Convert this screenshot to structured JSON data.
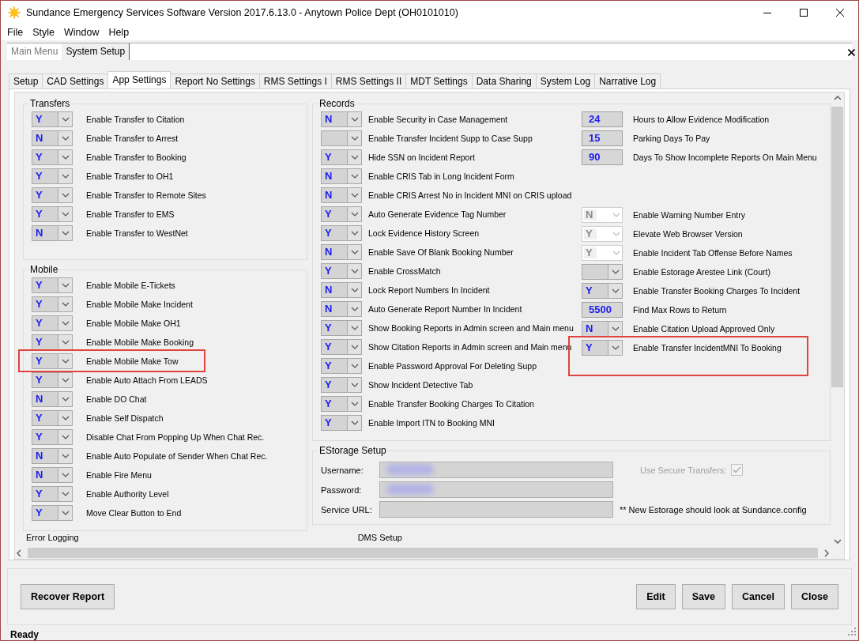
{
  "window": {
    "title": "Sundance Emergency Services Software Version 2017.6.13.0 - Anytown Police Dept (OH0101010)"
  },
  "menu": [
    "File",
    "Style",
    "Window",
    "Help"
  ],
  "doc_tabs": [
    {
      "label": "Main Menu",
      "selected": false
    },
    {
      "label": "System Setup",
      "selected": true
    }
  ],
  "tabs": [
    {
      "label": "Setup",
      "selected": false
    },
    {
      "label": "CAD Settings",
      "selected": false
    },
    {
      "label": "App Settings",
      "selected": true
    },
    {
      "label": "Report No Settings",
      "selected": false
    },
    {
      "label": "RMS Settings I",
      "selected": false
    },
    {
      "label": "RMS Settings II",
      "selected": false
    },
    {
      "label": "MDT Settings",
      "selected": false
    },
    {
      "label": "Data Sharing",
      "selected": false
    },
    {
      "label": "System Log",
      "selected": false
    },
    {
      "label": "Narrative Log",
      "selected": false
    }
  ],
  "transfers": {
    "title": "Transfers",
    "items": [
      {
        "kind": "combo",
        "value": "Y",
        "label": "Enable Transfer to Citation",
        "disabled": false,
        "highlighted": false
      },
      {
        "kind": "combo",
        "value": "N",
        "label": "Enable Transfer to Arrest",
        "disabled": false,
        "highlighted": false
      },
      {
        "kind": "combo",
        "value": "Y",
        "label": "Enable Transfer to Booking",
        "disabled": false,
        "highlighted": false
      },
      {
        "kind": "combo",
        "value": "Y",
        "label": "Enable Transfer to OH1",
        "disabled": false,
        "highlighted": false
      },
      {
        "kind": "combo",
        "value": "Y",
        "label": "Enable Transfer to Remote Sites",
        "disabled": false,
        "highlighted": false
      },
      {
        "kind": "combo",
        "value": "Y",
        "label": "Enable Transfer to EMS",
        "disabled": false,
        "highlighted": false
      },
      {
        "kind": "combo",
        "value": "N",
        "label": "Enable Transfer to WestNet",
        "disabled": false,
        "highlighted": false
      }
    ]
  },
  "mobile": {
    "title": "Mobile",
    "items": [
      {
        "kind": "combo",
        "value": "Y",
        "label": "Enable Mobile E-Tickets",
        "disabled": false,
        "highlighted": false
      },
      {
        "kind": "combo",
        "value": "Y",
        "label": "Enable Mobile Make Incident",
        "disabled": false,
        "highlighted": false
      },
      {
        "kind": "combo",
        "value": "Y",
        "label": "Enable Mobile Make OH1",
        "disabled": false,
        "highlighted": false
      },
      {
        "kind": "combo",
        "value": "Y",
        "label": "Enable Mobile Make Booking",
        "disabled": false,
        "highlighted": false
      },
      {
        "kind": "combo",
        "value": "Y",
        "label": "Enable Mobile Make Tow",
        "disabled": false,
        "highlighted": true
      },
      {
        "kind": "combo",
        "value": "Y",
        "label": "Enable Auto Attach From LEADS",
        "disabled": false,
        "highlighted": false
      },
      {
        "kind": "combo",
        "value": "N",
        "label": "Enable DO Chat",
        "disabled": false,
        "highlighted": false
      },
      {
        "kind": "combo",
        "value": "Y",
        "label": "Enable Self Dispatch",
        "disabled": false,
        "highlighted": false
      },
      {
        "kind": "combo",
        "value": "Y",
        "label": "Disable Chat From Popping Up When Chat Rec.",
        "disabled": false,
        "highlighted": false
      },
      {
        "kind": "combo",
        "value": "N",
        "label": "Enable Auto Populate of Sender When Chat Rec.",
        "disabled": false,
        "highlighted": false
      },
      {
        "kind": "combo",
        "value": "N",
        "label": "Enable Fire Menu",
        "disabled": false,
        "highlighted": false
      },
      {
        "kind": "combo",
        "value": "Y",
        "label": "Enable Authority Level",
        "disabled": false,
        "highlighted": false
      },
      {
        "kind": "combo",
        "value": "Y",
        "label": "Move Clear Button to End",
        "disabled": false,
        "highlighted": false
      }
    ]
  },
  "records": {
    "title": "Records",
    "left": [
      {
        "kind": "combo",
        "value": "N",
        "label": "Enable Security in Case Management",
        "disabled": false,
        "highlighted": false
      },
      {
        "kind": "combo",
        "label": "Enable Transfer Incident Supp to Case Supp",
        "disabled": false,
        "highlighted": false
      },
      {
        "kind": "combo",
        "value": "Y",
        "label": "Hide SSN on Incident Report",
        "disabled": false,
        "highlighted": false
      },
      {
        "kind": "combo",
        "value": "N",
        "label": "Enable CRIS Tab in Long Incident Form",
        "disabled": false,
        "highlighted": false
      },
      {
        "kind": "combo",
        "value": "N",
        "label": "Enable CRIS Arrest No in Incident MNI on CRIS upload",
        "disabled": false,
        "highlighted": false
      },
      {
        "kind": "combo",
        "value": "Y",
        "label": "Auto Generate Evidence Tag Number",
        "disabled": false,
        "highlighted": false
      },
      {
        "kind": "combo",
        "value": "Y",
        "label": "Lock Evidence History Screen",
        "disabled": false,
        "highlighted": false
      },
      {
        "kind": "combo",
        "value": "N",
        "label": "Enable Save Of Blank Booking Number",
        "disabled": false,
        "highlighted": false
      },
      {
        "kind": "combo",
        "value": "Y",
        "label": "Enable CrossMatch",
        "disabled": false,
        "highlighted": false
      },
      {
        "kind": "combo",
        "value": "N",
        "label": "Lock Report Numbers In Incident",
        "disabled": false,
        "highlighted": false
      },
      {
        "kind": "combo",
        "value": "N",
        "label": "Auto Generate Report Number In Incident",
        "disabled": false,
        "highlighted": false
      },
      {
        "kind": "combo",
        "value": "Y",
        "label": "Show Booking Reports in Admin screen and Main menu",
        "disabled": false,
        "highlighted": false
      },
      {
        "kind": "combo",
        "value": "Y",
        "label": "Show Citation Reports in Admin screen and Main menu",
        "disabled": false,
        "highlighted": false
      },
      {
        "kind": "combo",
        "value": "Y",
        "label": "Enable Password Approval For Deleting Supp",
        "disabled": false,
        "highlighted": false
      },
      {
        "kind": "combo",
        "value": "Y",
        "label": "Show Incident Detective Tab",
        "disabled": false,
        "highlighted": false
      },
      {
        "kind": "combo",
        "value": "Y",
        "label": "Enable Transfer Booking Charges To Citation",
        "disabled": false,
        "highlighted": false
      },
      {
        "kind": "combo",
        "value": "Y",
        "label": "Enable Import ITN to Booking MNI",
        "disabled": false,
        "highlighted": false
      }
    ],
    "right_top": [
      {
        "kind": "number",
        "value": "24",
        "label": "Hours to Allow Evidence Modification",
        "highlighted": false
      },
      {
        "kind": "number",
        "value": "15",
        "label": "Parking Days To Pay",
        "highlighted": false
      },
      {
        "kind": "number",
        "value": "90",
        "label": "Days To Show Incomplete Reports On Main Menu",
        "highlighted": false
      }
    ],
    "right_bottom": [
      {
        "kind": "combo",
        "value": "N",
        "label": "Enable Warning Number Entry",
        "disabled": true,
        "highlighted": false
      },
      {
        "kind": "combo",
        "value": "Y",
        "label": "Elevate Web Browser Version",
        "disabled": true,
        "highlighted": false
      },
      {
        "kind": "combo",
        "value": "Y",
        "label": "Enable Incident Tab Offense Before Names",
        "disabled": true,
        "highlighted": false
      },
      {
        "kind": "combo",
        "label": "Enable Estorage Arestee Link (Court)",
        "disabled": false,
        "highlighted": false
      },
      {
        "kind": "combo",
        "value": "Y",
        "label": "Enable Transfer Booking Charges To Incident",
        "disabled": false,
        "highlighted": false
      },
      {
        "kind": "number",
        "value": "5500",
        "label": "Find Max Rows to Return",
        "highlighted": false
      },
      {
        "kind": "combo",
        "value": "N",
        "label": "Enable Citation Upload Approved Only",
        "disabled": false,
        "highlighted": false
      },
      {
        "kind": "combo",
        "value": "Y",
        "label": "Enable Transfer IncidentMNI To Booking",
        "disabled": false,
        "highlighted": true
      }
    ]
  },
  "estorage": {
    "title": "EStorage Setup",
    "fields": [
      {
        "label": "Username:",
        "redacted": true
      },
      {
        "label": "Password:",
        "redacted": true
      },
      {
        "label": "Service URL:",
        "redacted": false
      }
    ],
    "secure": {
      "label": "Use Secure Transfers:",
      "checked": true,
      "disabled": true
    },
    "note": "** New Estorage should look at Sundance.config"
  },
  "cut_groups": [
    "Error Logging",
    "DMS Setup"
  ],
  "buttons_left": [
    "Recover Report"
  ],
  "buttons_right": [
    "Edit",
    "Save",
    "Cancel",
    "Close"
  ],
  "status_bar": "Ready"
}
